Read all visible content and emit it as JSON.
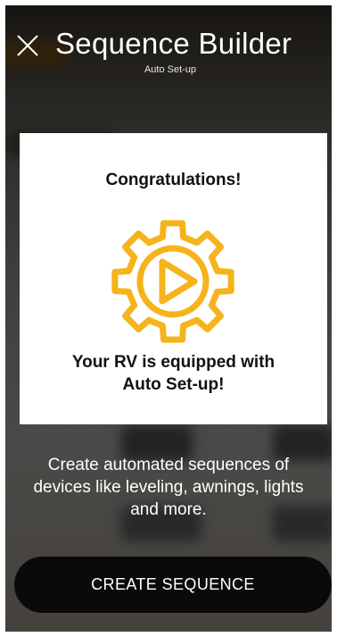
{
  "header": {
    "title": "Sequence Builder",
    "subtitle": "Auto Set-up",
    "close_icon": "close-icon"
  },
  "card": {
    "heading": "Congratulations!",
    "icon": "gear-play-icon",
    "message_line1": "Your RV is equipped with",
    "message_line2": "Auto Set-up!"
  },
  "description": "Create automated sequences of devices like leveling, awnings, lights and more.",
  "cta": {
    "label": "CREATE SEQUENCE"
  },
  "colors": {
    "accent": "#f5b31c",
    "button_bg": "#0a0a0a",
    "card_bg": "#ffffff"
  }
}
